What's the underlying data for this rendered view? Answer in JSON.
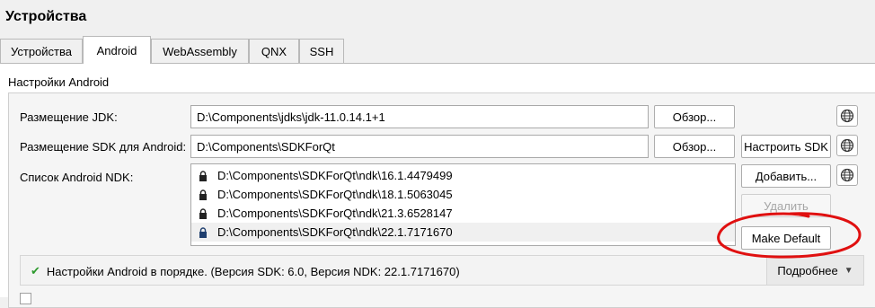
{
  "page_title": "Устройства",
  "tabs": [
    {
      "label": "Устройства",
      "active": false
    },
    {
      "label": "Android",
      "active": true
    },
    {
      "label": "WebAssembly",
      "active": false
    },
    {
      "label": "QNX",
      "active": false
    },
    {
      "label": "SSH",
      "active": false
    }
  ],
  "group_title": "Настройки Android",
  "jdk": {
    "label": "Размещение JDK:",
    "value": "D:\\Components\\jdks\\jdk-11.0.14.1+1",
    "browse_label": "Обзор..."
  },
  "sdk": {
    "label": "Размещение SDK для Android:",
    "value": "D:\\Components\\SDKForQt",
    "browse_label": "Обзор...",
    "setup_label": "Настроить SDK"
  },
  "ndk": {
    "label": "Список Android NDK:",
    "items": [
      {
        "path": "D:\\Components\\SDKForQt\\ndk\\16.1.4479499",
        "icon": "lock-icon",
        "selected": false
      },
      {
        "path": "D:\\Components\\SDKForQt\\ndk\\18.1.5063045",
        "icon": "lock-icon",
        "selected": false
      },
      {
        "path": "D:\\Components\\SDKForQt\\ndk\\21.3.6528147",
        "icon": "lock-icon",
        "selected": false
      },
      {
        "path": "D:\\Components\\SDKForQt\\ndk\\22.1.7171670",
        "icon": "lock-icon",
        "selected": true
      }
    ],
    "add_label": "Добавить...",
    "remove_label": "Удалить",
    "make_default_label": "Make Default"
  },
  "status": {
    "text": "Настройки Android в порядке. (Версия SDK: 6.0, Версия NDK: 22.1.7171670)",
    "icon": "check-icon",
    "details_label": "Подробнее"
  },
  "colors": {
    "annotation": "#e01010",
    "status_ok": "#2e9a2e"
  }
}
